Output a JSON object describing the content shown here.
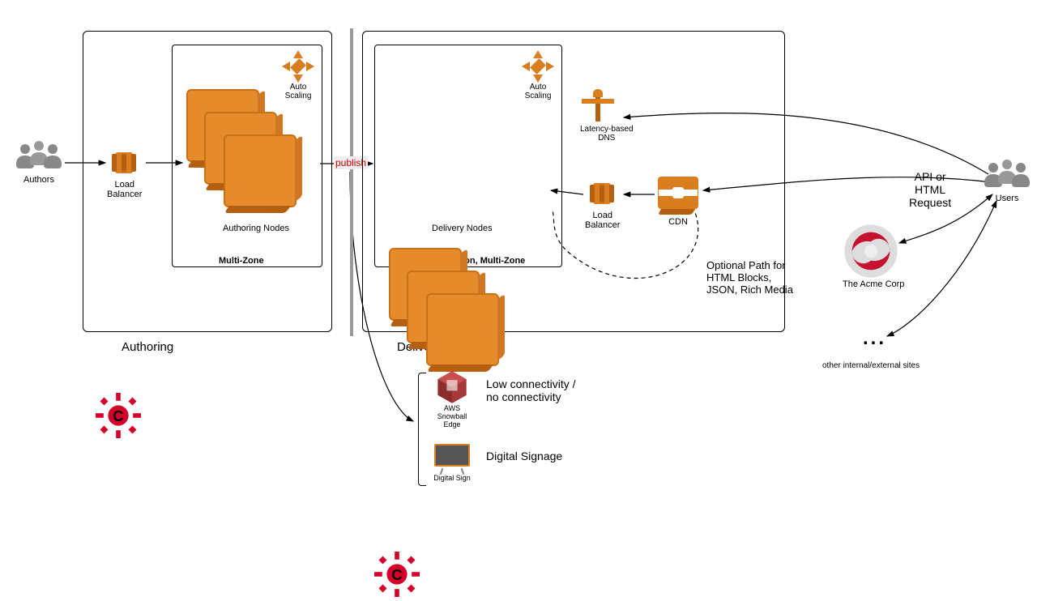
{
  "diagram": {
    "authors_label": "Authors",
    "users_label": "Users",
    "authoring": {
      "title": "Authoring",
      "zone_label": "Multi-Zone",
      "lb_label": "Load\nBalancer",
      "nodes_label": "Authoring Nodes",
      "autoscale_label": "Auto\nScaling"
    },
    "delivery": {
      "title": "Delivery",
      "zone_label": "Multi-Region, Multi-Zone",
      "lb_label": "Load\nBalancer",
      "nodes_label": "Delivery Nodes",
      "autoscale_label": "Auto\nScaling",
      "dns_label": "Latency-based\nDNS",
      "cdn_label": "CDN"
    },
    "publish_label": "publish",
    "request_label": "API or\nHTML\nRequest",
    "optional_path_label": "Optional Path for\nHTML Blocks,\nJSON, Rich Media",
    "acme_label": "The Acme Corp",
    "other_sites_label": "other internal/external sites",
    "snowball": {
      "title": "Low connectivity /\nno connectivity",
      "label": "AWS\nSnowball\nEdge"
    },
    "signage": {
      "title": "Digital Signage",
      "label": "Digital Sign"
    },
    "ellipsis": "..."
  }
}
